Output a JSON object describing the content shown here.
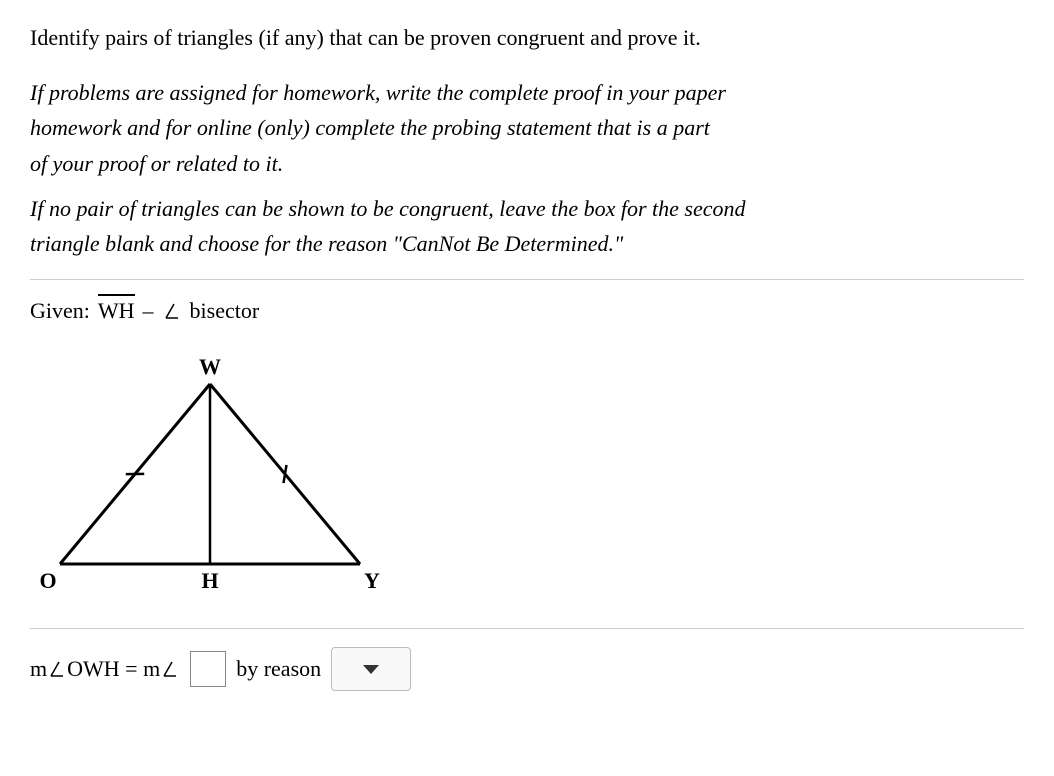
{
  "instruction": "Identify pairs of triangles (if any) that can be proven congruent and prove it.",
  "italic1_line1": "If problems are assigned for homework, write the complete proof in your paper",
  "italic1_line2": "homework and for online (only) complete the probing statement that is a part",
  "italic1_line3": "of your proof or related to it.",
  "italic2_line1": "If no pair of triangles can be shown to be congruent, leave the box for the second",
  "italic2_line2": "triangle blank and choose for the reason \"CanNot Be Determined.\"",
  "given": {
    "label": "Given:",
    "segment": "WH",
    "dash": "–",
    "text": "bisector"
  },
  "diagram": {
    "vertices": {
      "W": "W",
      "O": "O",
      "H": "H",
      "Y": "Y"
    }
  },
  "answer": {
    "lhs_prefix": "m",
    "lhs_angle": "OWH",
    "equals": "=",
    "rhs_prefix": "m",
    "by_reason": "by reason"
  }
}
